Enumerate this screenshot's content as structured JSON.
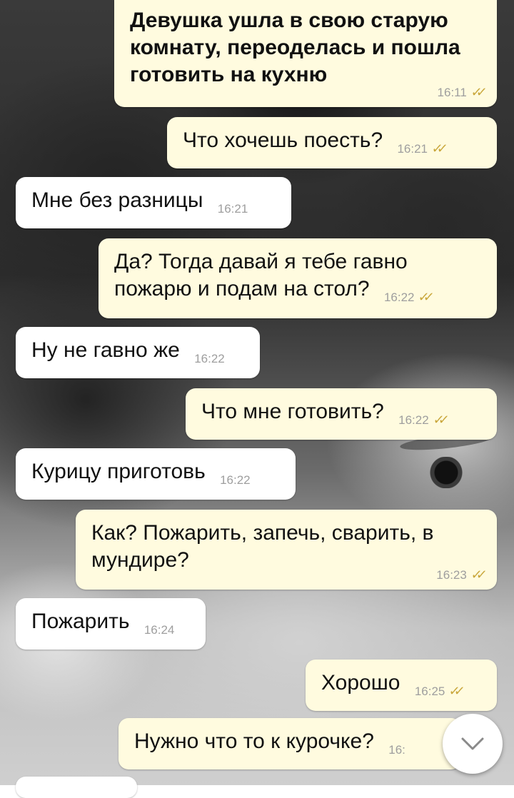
{
  "messages": [
    {
      "dir": "out",
      "text": "Девушка ушла в свою старую комнату, переоделась и пошла готовить на кухню",
      "time": "16:11",
      "read": true
    },
    {
      "dir": "out",
      "text": "Что хочешь поесть?",
      "time": "16:21",
      "read": true
    },
    {
      "dir": "in",
      "text": "Мне без разницы",
      "time": "16:21"
    },
    {
      "dir": "out",
      "text": "Да? Тогда давай я тебе гавно пожарю и подам на стол?",
      "time": "16:22",
      "read": true
    },
    {
      "dir": "in",
      "text": "Ну не гавно же",
      "time": "16:22"
    },
    {
      "dir": "out",
      "text": "Что мне готовить?",
      "time": "16:22",
      "read": true
    },
    {
      "dir": "in",
      "text": "Курицу приготовь",
      "time": "16:22"
    },
    {
      "dir": "out",
      "text": "Как? Пожарить, запечь, сварить, в мундире?",
      "time": "16:23",
      "read": true
    },
    {
      "dir": "in",
      "text": "Пожарить",
      "time": "16:24"
    },
    {
      "dir": "out",
      "text": "Хорошо",
      "time": "16:25",
      "read": true
    },
    {
      "dir": "out",
      "text": "Нужно что то к курочке?",
      "time": "16:",
      "read": false
    }
  ],
  "icons": {
    "read_receipt": "double-check-icon",
    "scroll_down": "chevron-down-icon"
  },
  "colors": {
    "outgoing_bubble": "#fffbdf",
    "incoming_bubble": "#ffffff",
    "read_check": "#c9a63a",
    "time_text": "#9e9e9e"
  }
}
